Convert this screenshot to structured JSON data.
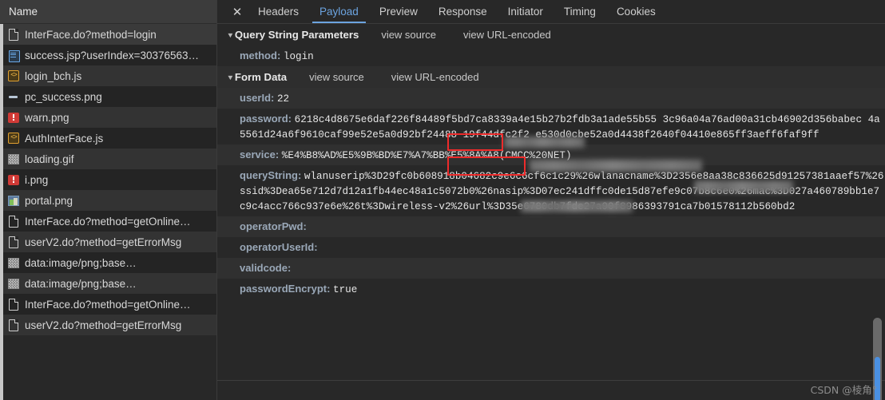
{
  "theme": {
    "bg": "#282828",
    "panel_bg": "#333333",
    "accent_blue": "#6ca4e0",
    "highlight_red": "#ee2b2b",
    "key_color": "#9aa8b8",
    "scrollbar_thumb": "#4a90e2"
  },
  "sidebar": {
    "header_label": "Name",
    "items": [
      {
        "name": "InterFace.do?method=login",
        "icon": "document-icon",
        "selected": true
      },
      {
        "name": "success.jsp?userIndex=30376563…",
        "icon": "html-document-icon",
        "selected": false
      },
      {
        "name": "login_bch.js",
        "icon": "script-icon",
        "selected": false
      },
      {
        "name": "pc_success.png",
        "icon": "dash-image-icon",
        "selected": false
      },
      {
        "name": "warn.png",
        "icon": "red-warning-image-icon",
        "selected": false
      },
      {
        "name": "AuthInterFace.js",
        "icon": "script-icon",
        "selected": false
      },
      {
        "name": "loading.gif",
        "icon": "image-icon",
        "selected": false
      },
      {
        "name": "i.png",
        "icon": "red-warning-image-icon",
        "selected": false
      },
      {
        "name": "portal.png",
        "icon": "color-image-icon",
        "selected": false
      },
      {
        "name": "InterFace.do?method=getOnline…",
        "icon": "document-icon",
        "selected": false
      },
      {
        "name": "userV2.do?method=getErrorMsg",
        "icon": "document-icon",
        "selected": false
      },
      {
        "name": "data:image/png;base…",
        "icon": "image-icon",
        "selected": false
      },
      {
        "name": "data:image/png;base…",
        "icon": "image-icon",
        "selected": false
      },
      {
        "name": "InterFace.do?method=getOnline…",
        "icon": "document-icon",
        "selected": false
      },
      {
        "name": "userV2.do?method=getErrorMsg",
        "icon": "document-icon",
        "selected": false
      }
    ]
  },
  "tabbar": {
    "close_label": "✕",
    "tabs": [
      {
        "label": "Headers",
        "active": false
      },
      {
        "label": "Payload",
        "active": true
      },
      {
        "label": "Preview",
        "active": false
      },
      {
        "label": "Response",
        "active": false
      },
      {
        "label": "Initiator",
        "active": false
      },
      {
        "label": "Timing",
        "active": false
      },
      {
        "label": "Cookies",
        "active": false
      }
    ]
  },
  "payload": {
    "query_string": {
      "title": "Query String Parameters",
      "view_source_label": "view source",
      "view_url_encoded_label": "view URL-encoded",
      "params": [
        {
          "key": "method:",
          "value": "login"
        }
      ]
    },
    "form_data": {
      "title": "Form Data",
      "view_source_label": "view source",
      "view_url_encoded_label": "view URL-encoded",
      "params": [
        {
          "key": "userId:",
          "value": "22",
          "redacted": true,
          "highlighted": true
        },
        {
          "key": "password:",
          "value": "6218c4d8675e6daf226f84489f5bd7ca8339a4e15b27b2fdb3a1ade55b55 3c96a04a76ad00a31cb46902d356babec 4a5561d24a6f9610caf99e52e5a0d92bf24488 19f44dfc2f2 e530d0cbe52a0d4438f2640f04410e865ff3aeff6faf9ff",
          "redacted": true,
          "highlighted": true
        },
        {
          "key": "service:",
          "value": "%E4%B8%AD%E5%9B%BD%E7%A7%BB%E5%8A%A8(CMCC%20NET)",
          "redacted": false,
          "highlighted": false
        },
        {
          "key": "queryString:",
          "value": "wlanuserip%3D29fc0b608918b04682c9e6c6cf6c1c29%26wlanacname%3D2356e8aa38c836625d91257381aaef57%26ssid%3Dea65e712d7d12a1fb44ec48a1c5072b0%26nasip%3D07ec241dffc0de15d87efe9c07b8c6e0%26mac%3D027a460789bb1e7c9c4acc766c937e6e%26t%3Dwireless-v2%26url%3D35e6780db7fde27a90f8986393791ca7b01578112b560bd2",
          "redacted": false,
          "highlighted": false
        },
        {
          "key": "operatorPwd:",
          "value": "",
          "redacted": false,
          "highlighted": false
        },
        {
          "key": "operatorUserId:",
          "value": "",
          "redacted": false,
          "highlighted": false
        },
        {
          "key": "validcode:",
          "value": "",
          "redacted": false,
          "highlighted": false
        },
        {
          "key": "passwordEncrypt:",
          "value": "true",
          "redacted": false,
          "highlighted": false
        }
      ]
    }
  },
  "scrollbar": {
    "orientation": "vertical",
    "thumb_color": "#4a90e2"
  },
  "watermark": "CSDN @棱角°"
}
